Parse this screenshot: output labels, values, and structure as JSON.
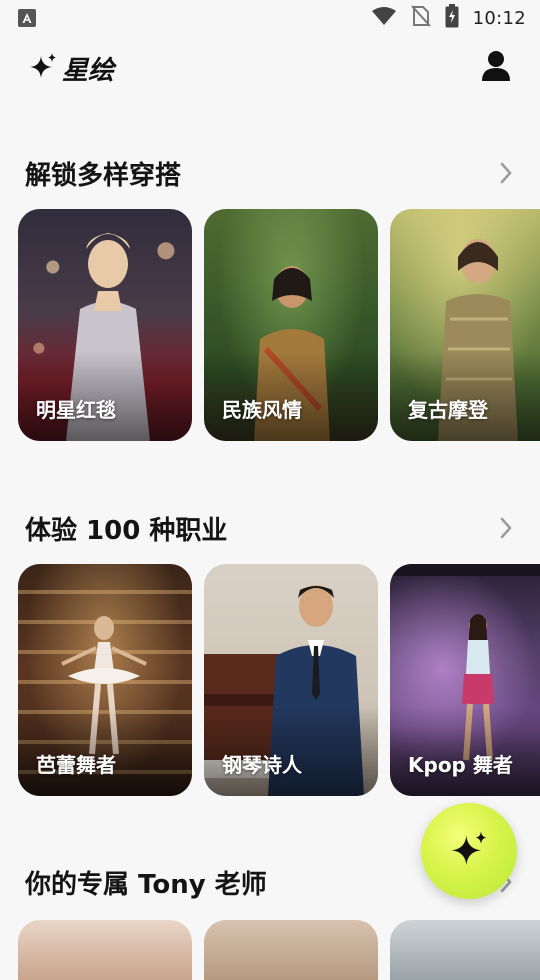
{
  "status_bar": {
    "time": "10:12",
    "notification_icon": "a-badge-icon",
    "icons": [
      "wifi-icon",
      "no-sim-icon",
      "battery-charging-icon"
    ]
  },
  "header": {
    "app_name": "星绘",
    "logo_icon": "sparkle-icon",
    "profile_icon": "person-icon"
  },
  "sections": [
    {
      "title": "解锁多样穿搭",
      "cards": [
        {
          "label": "明星红毯"
        },
        {
          "label": "民族风情"
        },
        {
          "label": "复古摩登"
        }
      ]
    },
    {
      "title": "体验 100 种职业",
      "cards": [
        {
          "label": "芭蕾舞者"
        },
        {
          "label": "钢琴诗人"
        },
        {
          "label": "Kpop 舞者"
        }
      ]
    },
    {
      "title": "你的专属 Tony 老师",
      "cards": [
        {
          "label": ""
        },
        {
          "label": ""
        },
        {
          "label": ""
        }
      ]
    }
  ],
  "fab": {
    "icon": "sparkle-icon"
  },
  "colors": {
    "background": "#f7f7f7",
    "fab_start": "#f2ff7a",
    "fab_end": "#b6ea3a",
    "text": "#141414"
  }
}
